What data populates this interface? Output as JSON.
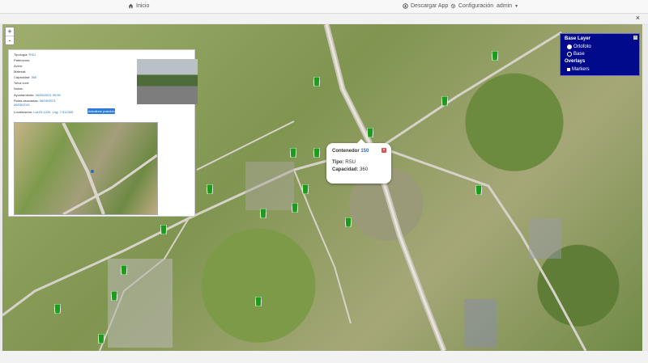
{
  "navbar": {
    "home_label": "Inicio",
    "download_label": "Descargar App",
    "config_label": "Configuración",
    "user_label": "admin"
  },
  "map": {
    "zoom_in": "+",
    "zoom_out": "-",
    "close": "×",
    "layers": {
      "base_title": "Base Layer",
      "base_options": [
        "Ortofoto",
        "Base"
      ],
      "overlays_title": "Overlays",
      "overlay_options": [
        "Markers"
      ]
    },
    "popup": {
      "title": "Contenedor",
      "id": "150",
      "type_label": "Tipo:",
      "type_value": "RSU",
      "capacity_label": "Capacidad:",
      "capacity_value": "360"
    }
  },
  "info_panel": {
    "fields": [
      {
        "label": "Tipología:",
        "value": "RSU"
      },
      {
        "label": "Patrimonio:",
        "value": ""
      },
      {
        "label": "Avión:",
        "value": ""
      },
      {
        "label": "Material:",
        "value": ""
      },
      {
        "label": "Capacidad:",
        "value": "360"
      },
      {
        "label": "Tolva cont:",
        "value": ""
      },
      {
        "label": "Notas:",
        "value": ""
      },
      {
        "label": "Ayuntamiento:",
        "value": "06/05/2021 09:50"
      },
      {
        "label": "Rutas asociadas:",
        "value": "06/05/2021"
      },
      {
        "label": "",
        "value": "06/05/2021"
      },
      {
        "label": "Localización:",
        "value": "Lat:43.1234, Lng:-7.512345"
      }
    ],
    "update_button": "Actualizar posición",
    "minimap_close": "×"
  },
  "colors": {
    "layers_bg": "#000a8a",
    "marker": "#1f9a1f",
    "button": "#2f7cd6"
  }
}
